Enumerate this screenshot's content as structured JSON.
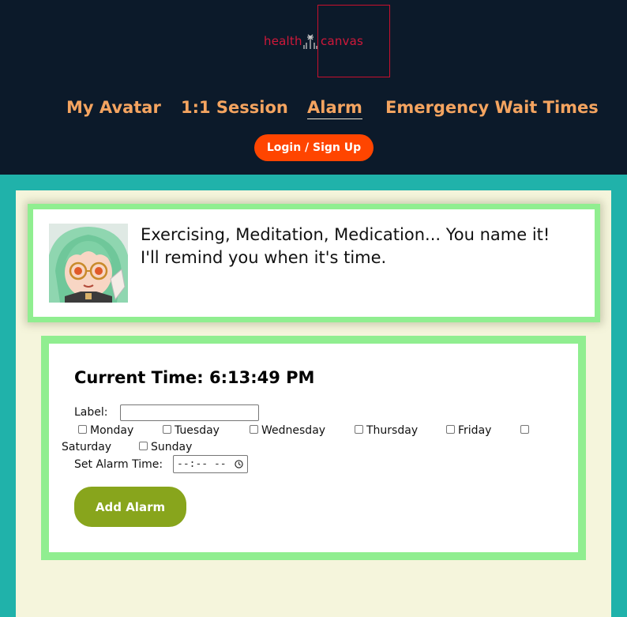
{
  "header": {
    "logo": {
      "left_text": "health",
      "right_text": "canvas",
      "icon": "signal-tower-icon"
    },
    "nav": [
      "My Avatar",
      "1:1 Session",
      "Alarm",
      "Emergency Wait Times"
    ],
    "active_nav": "Alarm",
    "login_label": "Login / Sign Up"
  },
  "intro": {
    "line1": "Exercising, Meditation, Medication... You name it!",
    "line2": "I'll remind you when it's time."
  },
  "alarm": {
    "current_time_label": "Current Time: 6:13:49 PM",
    "label_field_label": "Label:",
    "label_value": "",
    "days": [
      "Monday",
      "Tuesday",
      "Wednesday",
      "Thursday",
      "Friday",
      "Saturday",
      "Sunday"
    ],
    "set_time_label": "Set Alarm Time:",
    "time_placeholder": "--:-- --",
    "add_button": "Add Alarm"
  },
  "colors": {
    "header_bg": "#0c1a2a",
    "nav_text": "#f4a460",
    "login_bg": "#ff4500",
    "page_bg": "#20b2aa",
    "panel_bg": "#f5f5dc",
    "card_border": "#90ee90",
    "add_button_bg": "#88a51c",
    "logo_red": "#d0183a"
  }
}
